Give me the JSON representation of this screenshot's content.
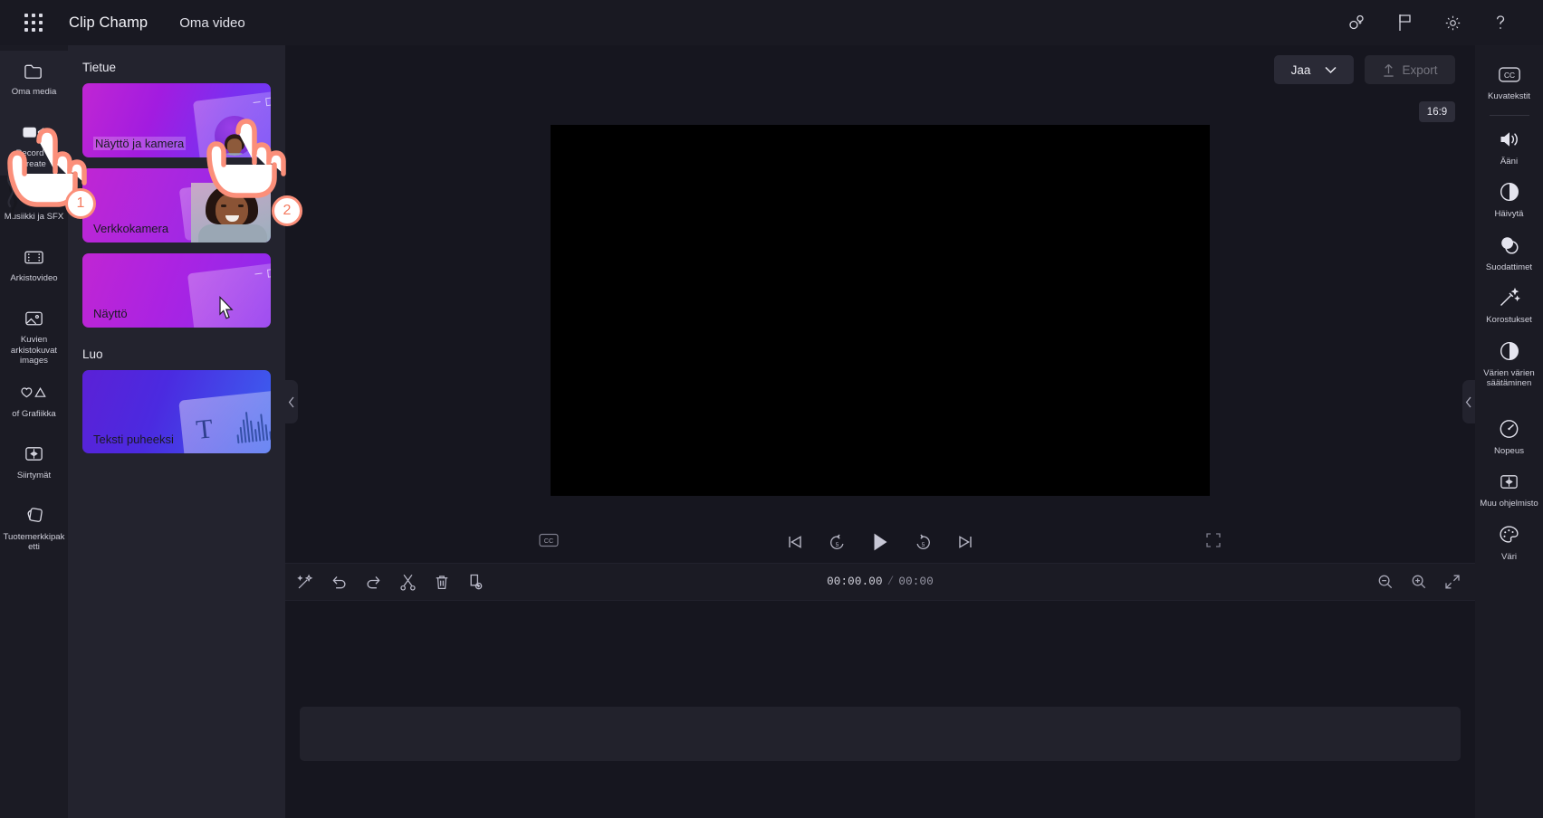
{
  "header": {
    "waffle_icon": "app-launcher-grid-icon",
    "brand": "Clip Champ",
    "project_name": "Oma video",
    "icons": [
      {
        "name": "share-people-icon",
        "label": "Collaborate"
      },
      {
        "name": "flag-feedback-icon",
        "label": "Feedback"
      },
      {
        "name": "gear-icon",
        "label": "Settings"
      },
      {
        "name": "help-question-icon",
        "label": "Help"
      }
    ]
  },
  "left_rail": {
    "items": [
      {
        "label": "Oma media",
        "icon": "folder-icon",
        "state": "active"
      },
      {
        "label": "Record & create",
        "icon": "video-camera-icon",
        "state": "selected"
      },
      {
        "label": "Musiikki ja SFX",
        "icon": "music-note-icon",
        "state": "normal"
      },
      {
        "label": "Arkistovideo",
        "icon": "film-strip-icon",
        "state": "normal"
      },
      {
        "label": "Kuvien arkistokuvat images",
        "icon": "image-icon",
        "state": "normal"
      },
      {
        "label": "of Grafiikka",
        "icon": "shapes-heart-triangle-icon",
        "state": "normal"
      },
      {
        "label": "Siirtymät",
        "icon": "transition-icon",
        "state": "normal"
      },
      {
        "label": "Tuotemerkkipaketti",
        "icon": "brand-kit-layers-icon",
        "state": "normal"
      }
    ]
  },
  "panel": {
    "section_record": "Tietue",
    "section_create": "Luo",
    "cards": [
      {
        "label": "Näyttö ja kamera",
        "highlighted": true
      },
      {
        "label": "Verkkokamera",
        "highlighted": false
      },
      {
        "label": "Näyttö",
        "highlighted": false
      },
      {
        "label": "Teksti puheeksi",
        "highlighted": false
      }
    ],
    "collapse_icon": "chevron-left-icon"
  },
  "stage": {
    "share_label": "Jaa",
    "share_chevron_icon": "chevron-down-icon",
    "export_label": "Export",
    "export_icon": "upload-arrow-icon",
    "export_enabled": false,
    "aspect_ratio": "16:9",
    "collapse_icon": "chevron-left-icon"
  },
  "player": {
    "cc_label": "CC",
    "controls": [
      {
        "name": "skip-to-start-icon"
      },
      {
        "name": "rewind-5-seconds-icon",
        "label": "5"
      },
      {
        "name": "play-icon"
      },
      {
        "name": "forward-5-seconds-icon",
        "label": "5"
      },
      {
        "name": "skip-to-end-icon"
      }
    ],
    "fullscreen_icon": "fullscreen-icon"
  },
  "timeline_toolbar": {
    "left_tools": [
      {
        "name": "magic-wand-sparkle-icon"
      },
      {
        "name": "undo-icon"
      },
      {
        "name": "redo-icon"
      },
      {
        "name": "split-scissors-icon"
      },
      {
        "name": "delete-trash-icon"
      },
      {
        "name": "duplicate-icon"
      }
    ],
    "current_time": "00:00.00",
    "time_separator": "/",
    "total_time": "00:00",
    "right_tools": [
      {
        "name": "zoom-out-icon"
      },
      {
        "name": "zoom-in-icon"
      },
      {
        "name": "fit-to-screen-icon"
      }
    ]
  },
  "right_rail": {
    "items": [
      {
        "label": "Kuvatekstit",
        "icon": "closed-captions-icon"
      },
      {
        "label": "Ääni",
        "icon": "speaker-volume-icon"
      },
      {
        "label": "Häivytä",
        "icon": "fade-circle-icon"
      },
      {
        "label": "Suodattimet",
        "icon": "filters-overlap-circles-icon"
      },
      {
        "label": "Korostukset",
        "icon": "magic-wand-adjust-icon"
      },
      {
        "label": "Värien värien säätäminen",
        "icon": "color-balance-half-circle-icon"
      },
      {
        "label": "Nopeus",
        "icon": "speedometer-icon"
      },
      {
        "label": "Muu ohjelmisto",
        "icon": "transition-icon"
      },
      {
        "label": "Väri",
        "icon": "color-palette-icon"
      }
    ]
  },
  "tutorial": {
    "steps": [
      {
        "number": "1",
        "target": "Record & create rail item"
      },
      {
        "number": "2",
        "target": "Näyttö ja kamera card"
      }
    ],
    "hand_icon": "pointing-hand-icon",
    "accent_color": "#fb8f7a",
    "badge_text_color": "#f4795e"
  },
  "colors": {
    "app_bg": "#16161f",
    "rail_bg": "#1b1b24",
    "panel_bg": "#23232e",
    "preview_bg": "#000000",
    "text_primary": "#e8e8ef",
    "text_muted": "#9a9aa8"
  }
}
